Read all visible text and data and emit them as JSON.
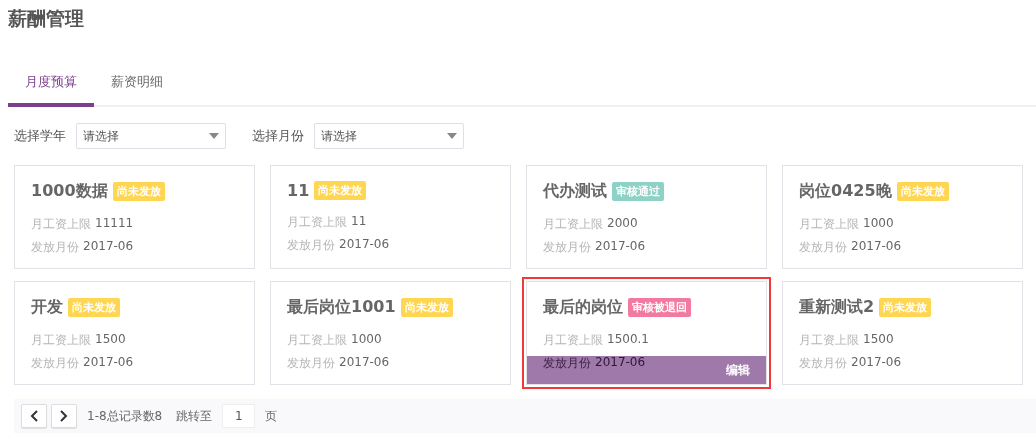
{
  "page_title": "薪酬管理",
  "tabs": [
    {
      "label": "月度预算",
      "selected": true
    },
    {
      "label": "薪资明细",
      "selected": false
    }
  ],
  "filters": [
    {
      "label": "选择学年",
      "placeholder": "请选择"
    },
    {
      "label": "选择月份",
      "placeholder": "请选择"
    }
  ],
  "cards": [
    {
      "title": "1000数据",
      "status": "尚未发放",
      "color": "#ffd652",
      "salary_label": "月工资上限",
      "salary": "11111",
      "month_label": "发放月份",
      "month": "2017-06",
      "hovered": false
    },
    {
      "title": "11",
      "status": "尚未发放",
      "color": "#ffd652",
      "salary_label": "月工资上限",
      "salary": "11",
      "month_label": "发放月份",
      "month": "2017-06",
      "hovered": false
    },
    {
      "title": "代办测试",
      "status": "审核通过",
      "color": "#8ed1c6",
      "salary_label": "月工资上限",
      "salary": "2000",
      "month_label": "发放月份",
      "month": "2017-06",
      "hovered": false
    },
    {
      "title": "岗位0425晚",
      "status": "尚未发放",
      "color": "#ffd652",
      "salary_label": "月工资上限",
      "salary": "1000",
      "month_label": "发放月份",
      "month": "2017-06",
      "hovered": false
    },
    {
      "title": "开发",
      "status": "尚未发放",
      "color": "#ffd652",
      "salary_label": "月工资上限",
      "salary": "1500",
      "month_label": "发放月份",
      "month": "2017-06",
      "hovered": false
    },
    {
      "title": "最后岗位1001",
      "status": "尚未发放",
      "color": "#ffd652",
      "salary_label": "月工资上限",
      "salary": "1000",
      "month_label": "发放月份",
      "month": "2017-06",
      "hovered": false
    },
    {
      "title": "最后的岗位",
      "status": "审核被退回",
      "color": "#f27aa0",
      "salary_label": "月工资上限",
      "salary": "1500.1",
      "month_label": "发放月份",
      "month": "2017-06",
      "hovered": true,
      "edit_label": "编辑"
    },
    {
      "title": "重新测试2",
      "status": "尚未发放",
      "color": "#ffd652",
      "salary_label": "月工资上限",
      "salary": "1500",
      "month_label": "发放月份",
      "month": "2017-06",
      "hovered": false
    }
  ],
  "pagination": {
    "summary": "1-8总记录数8",
    "jump_label": "跳转至",
    "page": "1",
    "page_unit": "页"
  }
}
